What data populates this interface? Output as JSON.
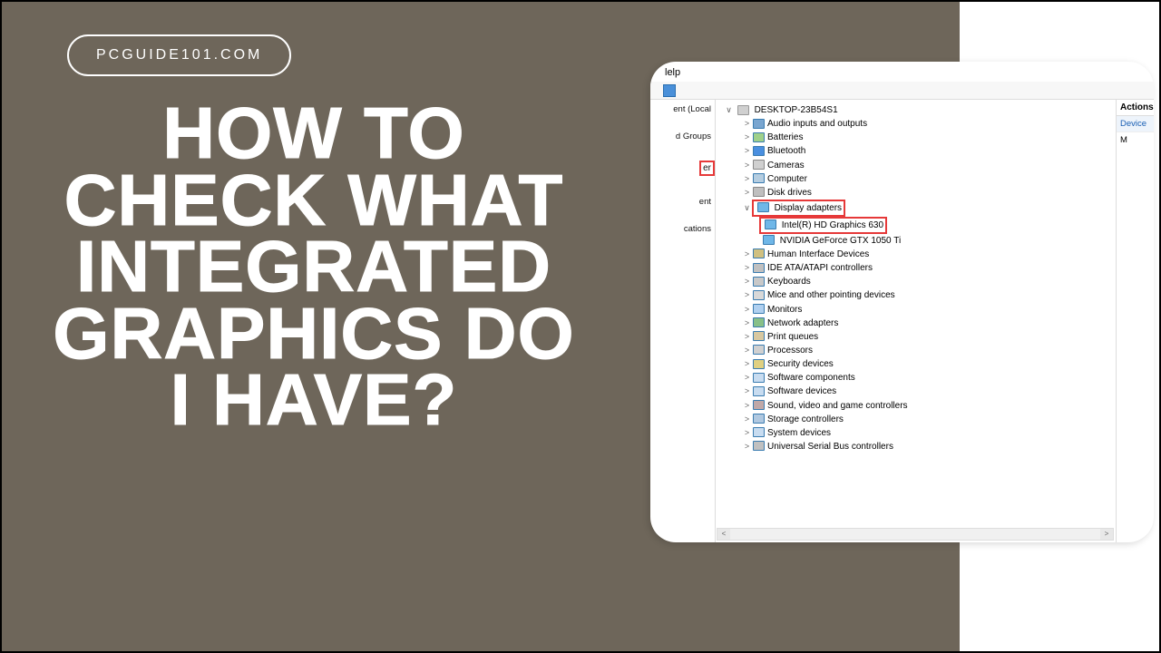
{
  "badge": "PCGUIDE101.COM",
  "headline": "HOW TO CHECK WHAT INTEGRATED GRAPHICS DO I HAVE?",
  "devmgr": {
    "menu_help": "lelp",
    "left_pane": {
      "root_suffix": "ent (Local",
      "groups_suffix": "d Groups",
      "selected_suffix": "er",
      "mgmt_suffix": "ent",
      "apps_suffix": "cations"
    },
    "root": "DESKTOP-23B54S1",
    "categories": [
      {
        "label": "Audio inputs and outputs",
        "icon": "aud"
      },
      {
        "label": "Batteries",
        "icon": "bat"
      },
      {
        "label": "Bluetooth",
        "icon": "bt"
      },
      {
        "label": "Cameras",
        "icon": "cam"
      },
      {
        "label": "Computer",
        "icon": "comp"
      },
      {
        "label": "Disk drives",
        "icon": "disk"
      }
    ],
    "display_adapters": {
      "label": "Display adapters",
      "children": [
        {
          "label": "Intel(R) HD Graphics 630",
          "highlight": true
        },
        {
          "label": "NVIDIA GeForce GTX 1050 Ti",
          "highlight": false
        }
      ]
    },
    "categories_after": [
      {
        "label": "Human Interface Devices",
        "icon": "hid"
      },
      {
        "label": "IDE ATA/ATAPI controllers",
        "icon": "ide"
      },
      {
        "label": "Keyboards",
        "icon": "kb"
      },
      {
        "label": "Mice and other pointing devices",
        "icon": "mouse"
      },
      {
        "label": "Monitors",
        "icon": "mon"
      },
      {
        "label": "Network adapters",
        "icon": "net"
      },
      {
        "label": "Print queues",
        "icon": "prn"
      },
      {
        "label": "Processors",
        "icon": "proc"
      },
      {
        "label": "Security devices",
        "icon": "sec"
      },
      {
        "label": "Software components",
        "icon": "soft"
      },
      {
        "label": "Software devices",
        "icon": "soft"
      },
      {
        "label": "Sound, video and game controllers",
        "icon": "snd"
      },
      {
        "label": "Storage controllers",
        "icon": "stor"
      },
      {
        "label": "System devices",
        "icon": "sys"
      },
      {
        "label": "Universal Serial Bus controllers",
        "icon": "usb"
      }
    ],
    "actions": {
      "header": "Actions",
      "link": "Device",
      "more": "M"
    }
  }
}
